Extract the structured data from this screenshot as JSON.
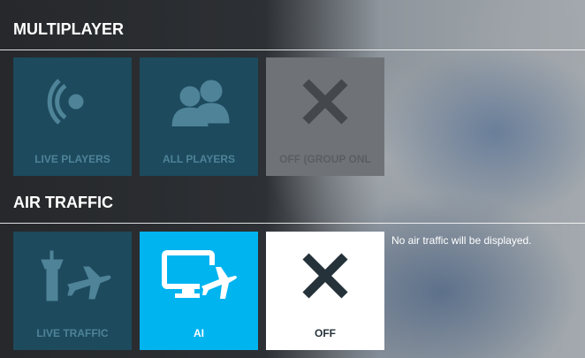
{
  "multiplayer": {
    "title": "MULTIPLAYER",
    "options": [
      {
        "label": "LIVE PLAYERS",
        "icon": "live-broadcast-icon",
        "state": "disabled"
      },
      {
        "label": "ALL PLAYERS",
        "icon": "users-icon",
        "state": "disabled"
      },
      {
        "label": "OFF (GROUP ONL",
        "icon": "close-icon",
        "state": "disabled"
      }
    ]
  },
  "air_traffic": {
    "title": "AIR TRAFFIC",
    "options": [
      {
        "label": "LIVE TRAFFIC",
        "icon": "control-tower-plane-icon",
        "state": "disabled"
      },
      {
        "label": "AI",
        "icon": "monitor-plane-icon",
        "state": "selected",
        "color": "#00b4f0"
      },
      {
        "label": "OFF",
        "icon": "close-icon",
        "state": "available"
      }
    ],
    "description": "No air traffic will be displayed."
  }
}
